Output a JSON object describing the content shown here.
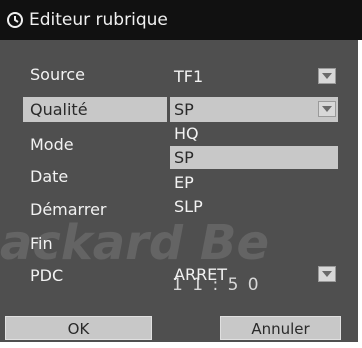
{
  "title": "Editeur rubrique",
  "clock_icon": "clock-icon",
  "fields": [
    {
      "label": "Source",
      "value": "TF1"
    },
    {
      "label": "Qualité",
      "value": "SP"
    },
    {
      "label": "Mode",
      "value": ""
    },
    {
      "label": "Date",
      "value": ""
    },
    {
      "label": "Démarrer",
      "value": ""
    },
    {
      "label": "Fin",
      "value": "1 1 : 5 0"
    },
    {
      "label": "PDC",
      "value": "ARRET"
    }
  ],
  "quality_options": [
    "HQ",
    "SP",
    "EP",
    "SLP"
  ],
  "selected_quality": "SP",
  "buttons": {
    "ok": "OK",
    "cancel": "Annuler"
  },
  "watermark": "ackard Be"
}
